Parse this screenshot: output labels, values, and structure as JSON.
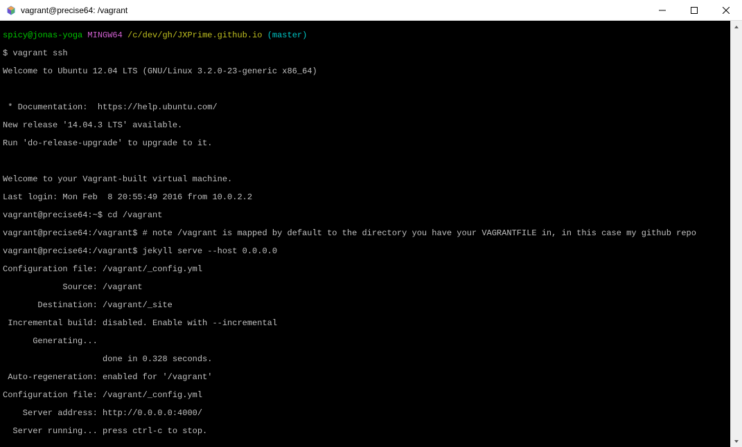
{
  "window": {
    "title": "vagrant@precise64: /vagrant"
  },
  "prompt": {
    "user_host": "spicy@jonas-yoga",
    "env": "MINGW64",
    "path": "/c/dev/gh/JXPrime.github.io",
    "branch": "(master)",
    "symbol": "$",
    "command": "vagrant ssh"
  },
  "lines": {
    "l1": "Welcome to Ubuntu 12.04 LTS (GNU/Linux 3.2.0-23-generic x86_64)",
    "l2": "",
    "l3": " * Documentation:  https://help.ubuntu.com/",
    "l4": "New release '14.04.3 LTS' available.",
    "l5": "Run 'do-release-upgrade' to upgrade to it.",
    "l6": "",
    "l7": "Welcome to your Vagrant-built virtual machine.",
    "l8": "Last login: Mon Feb  8 20:55:49 2016 from 10.0.2.2",
    "l9": "vagrant@precise64:~$ cd /vagrant",
    "l10": "vagrant@precise64:/vagrant$ # note /vagrant is mapped by default to the directory you have your VAGRANTFILE in, in this case my github repo",
    "l11": "vagrant@precise64:/vagrant$ jekyll serve --host 0.0.0.0",
    "l12": "Configuration file: /vagrant/_config.yml",
    "l13": "            Source: /vagrant",
    "l14": "       Destination: /vagrant/_site",
    "l15": " Incremental build: disabled. Enable with --incremental",
    "l16": "      Generating...",
    "l17": "                    done in 0.328 seconds.",
    "l18": " Auto-regeneration: enabled for '/vagrant'",
    "l19": "Configuration file: /vagrant/_config.yml",
    "l20": "    Server address: http://0.0.0.0:4000/",
    "l21": "  Server running... press ctrl-c to stop."
  }
}
